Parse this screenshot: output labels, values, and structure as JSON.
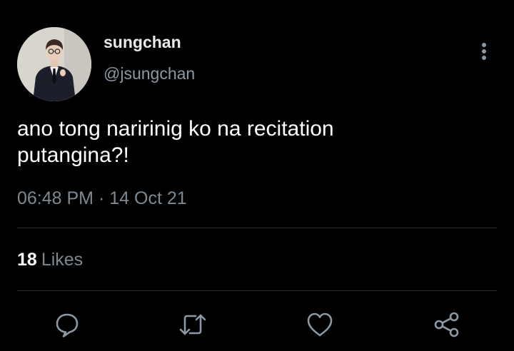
{
  "tweet": {
    "display_name": "sungchan",
    "handle": "@jsungchan",
    "text_line1": "ano tong naririnig ko na recitation",
    "text_line2": "putangina?!",
    "time": "06:48 PM",
    "separator": "·",
    "date": "14 Oct 21"
  },
  "stats": {
    "likes_count": "18",
    "likes_label": "Likes"
  },
  "actions": [
    "reply-icon",
    "retweet-icon",
    "like-icon",
    "share-icon"
  ],
  "colors": {
    "background": "#000000",
    "text": "#ffffff",
    "secondary_text": "#8b98a5",
    "divider": "#2a2e32"
  }
}
